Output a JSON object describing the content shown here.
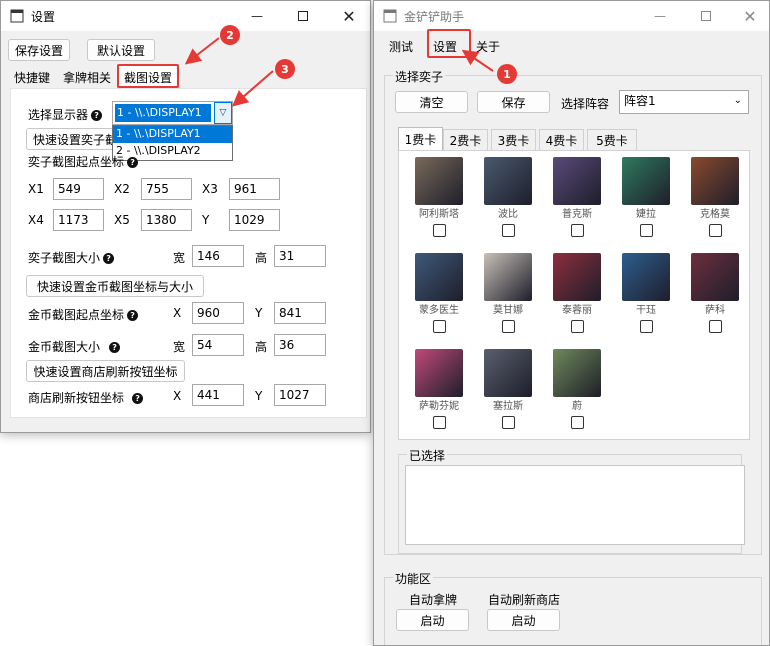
{
  "left_window": {
    "title": "设置",
    "buttons": {
      "save": "保存设置",
      "default": "默认设置"
    },
    "tabs": [
      "快捷键",
      "拿牌相关",
      "截图设置"
    ],
    "display_label": "选择显示器",
    "display_selected": "1 - \\\\.\\DISPLAY1",
    "display_options": [
      "1 - \\\\.\\DISPLAY1",
      "2 - \\\\.\\DISPLAY2"
    ],
    "quick_btn_1": "快速设置奕子截",
    "champ_start_label": "奕子截图起点坐标",
    "x1_label": "X1",
    "x1": "549",
    "x2_label": "X2",
    "x2": "755",
    "x3_label": "X3",
    "x3": "961",
    "x4_label": "X4",
    "x4": "1173",
    "x5_label": "X5",
    "x5": "1380",
    "y_label": "Y",
    "y": "1029",
    "champ_size_label": "奕子截图大小",
    "width_label": "宽",
    "width": "146",
    "height_label": "高",
    "height": "31",
    "quick_btn_2": "快速设置金币截图坐标与大小",
    "gold_start_label": "金币截图起点坐标",
    "gold_x_label": "X",
    "gold_x": "960",
    "gold_y_label": "Y",
    "gold_y": "841",
    "gold_size_label": "金币截图大小",
    "gold_w_label": "宽",
    "gold_w": "54",
    "gold_h_label": "高",
    "gold_h": "36",
    "quick_btn_3": "快速设置商店刷新按钮坐标",
    "refresh_label": "商店刷新按钮坐标",
    "refresh_x_label": "X",
    "refresh_x": "441",
    "refresh_y_label": "Y",
    "refresh_y": "1027"
  },
  "right_window": {
    "title": "金铲铲助手",
    "menu": [
      "测试",
      "设置",
      "关于"
    ],
    "group_select": "选择奕子",
    "clear": "清空",
    "save": "保存",
    "lineup_label": "选择阵容",
    "lineup_value": "阵容1",
    "cost_tabs": [
      "1费卡",
      "2费卡",
      "3费卡",
      "4费卡",
      "5费卡"
    ],
    "champions": [
      {
        "name": "阿利斯塔",
        "color": "#7a6a5a"
      },
      {
        "name": "波比",
        "color": "#4a5a6e"
      },
      {
        "name": "普克斯",
        "color": "#5a4a7a"
      },
      {
        "name": "婕拉",
        "color": "#2f7a5e"
      },
      {
        "name": "克格莫",
        "color": "#8a4a2e"
      },
      {
        "name": "蒙多医生",
        "color": "#3e5a7a"
      },
      {
        "name": "莫甘娜",
        "color": "#c8c0b8"
      },
      {
        "name": "泰蓉丽",
        "color": "#8e2e3e"
      },
      {
        "name": "干珏",
        "color": "#2e5e8e"
      },
      {
        "name": "萨科",
        "color": "#6e2e3e"
      },
      {
        "name": "萨勒芬妮",
        "color": "#c04a7a"
      },
      {
        "name": "塞拉斯",
        "color": "#5a5e6e"
      },
      {
        "name": "蔚",
        "color": "#6e8a5a"
      }
    ],
    "selected_group": "已选择",
    "function_group": "功能区",
    "auto_take_label": "自动拿牌",
    "auto_refresh_label": "自动刷新商店",
    "start1": "启动",
    "start2": "启动"
  },
  "annotations": {
    "m1": "1",
    "m2": "2",
    "m3": "3",
    "color": "#e53935"
  }
}
